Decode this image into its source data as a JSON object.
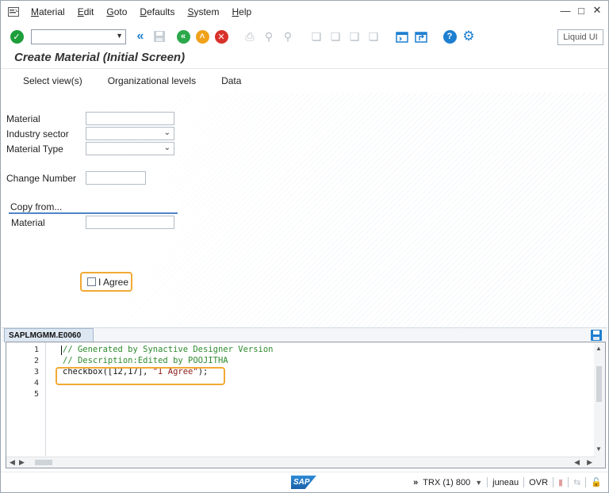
{
  "menu": {
    "items": [
      "Material",
      "Edit",
      "Goto",
      "Defaults",
      "System",
      "Help"
    ],
    "underline_keys": [
      "M",
      "E",
      "G",
      "D",
      "S",
      "H"
    ]
  },
  "toolbar": {
    "command_field_value": "",
    "liquid_ui_label": "Liquid UI",
    "help_badge": "?"
  },
  "screen": {
    "title": "Create Material (Initial Screen)",
    "app_toolbar": [
      "Select view(s)",
      "Organizational levels",
      "Data"
    ],
    "fields": {
      "material_label": "Material",
      "industry_sector_label": "Industry sector",
      "material_type_label": "Material Type",
      "change_number_label": "Change Number",
      "material_value": "",
      "industry_sector_value": "",
      "material_type_value": "",
      "change_number_value": ""
    },
    "copy_from": {
      "header": "Copy from...",
      "material_label": "Material",
      "material_value": ""
    },
    "checkbox": {
      "label": "I Agree",
      "checked": false
    }
  },
  "editor": {
    "tab_name": "SAPLMGMM.E0060",
    "line_numbers": [
      "1",
      "2",
      "3",
      "4",
      "5"
    ],
    "lines": [
      "// Generated by Synactive Designer Version",
      "// Description:Edited by POOJITHA",
      "checkbox([12,17], \"I Agree\");",
      "",
      ""
    ],
    "line3_parts": [
      "checkbox([12,17], ",
      "\"I Agree\"",
      ");"
    ]
  },
  "statusbar": {
    "logo": "SAP",
    "transaction": "TRX (1) 800",
    "server": "juneau",
    "mode": "OVR",
    "expand_glyph": "»"
  },
  "colors": {
    "accent_highlight": "#f2a935",
    "ok_green": "#1e9e3a",
    "nav_green": "#2aa84a",
    "exit_orange": "#f0a21a",
    "cancel_red": "#d9312b",
    "blue": "#1e7fd0"
  }
}
